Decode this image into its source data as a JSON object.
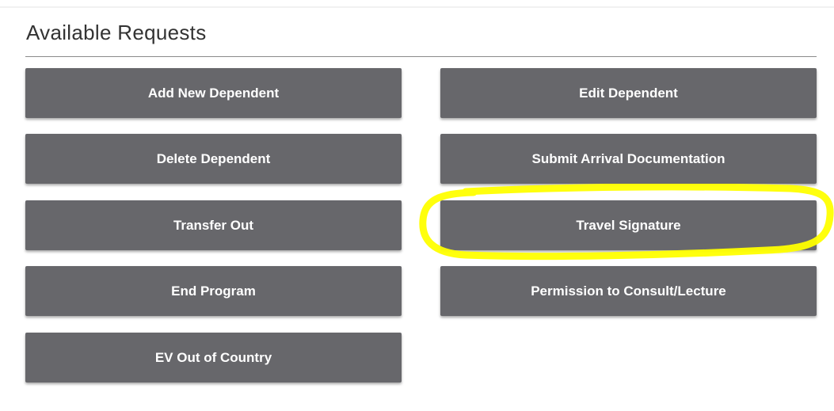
{
  "section": {
    "title": "Available Requests"
  },
  "requests": {
    "add_new_dependent": "Add New Dependent",
    "edit_dependent": "Edit Dependent",
    "delete_dependent": "Delete Dependent",
    "submit_arrival_documentation": "Submit Arrival Documentation",
    "transfer_out": "Transfer Out",
    "travel_signature": "Travel Signature",
    "end_program": "End Program",
    "permission_to_consult_lecture": "Permission to Consult/Lecture",
    "ev_out_of_country": "EV Out of Country"
  },
  "colors": {
    "button_bg": "#67676b",
    "button_text": "#ffffff",
    "highlight": "#ffff00"
  }
}
